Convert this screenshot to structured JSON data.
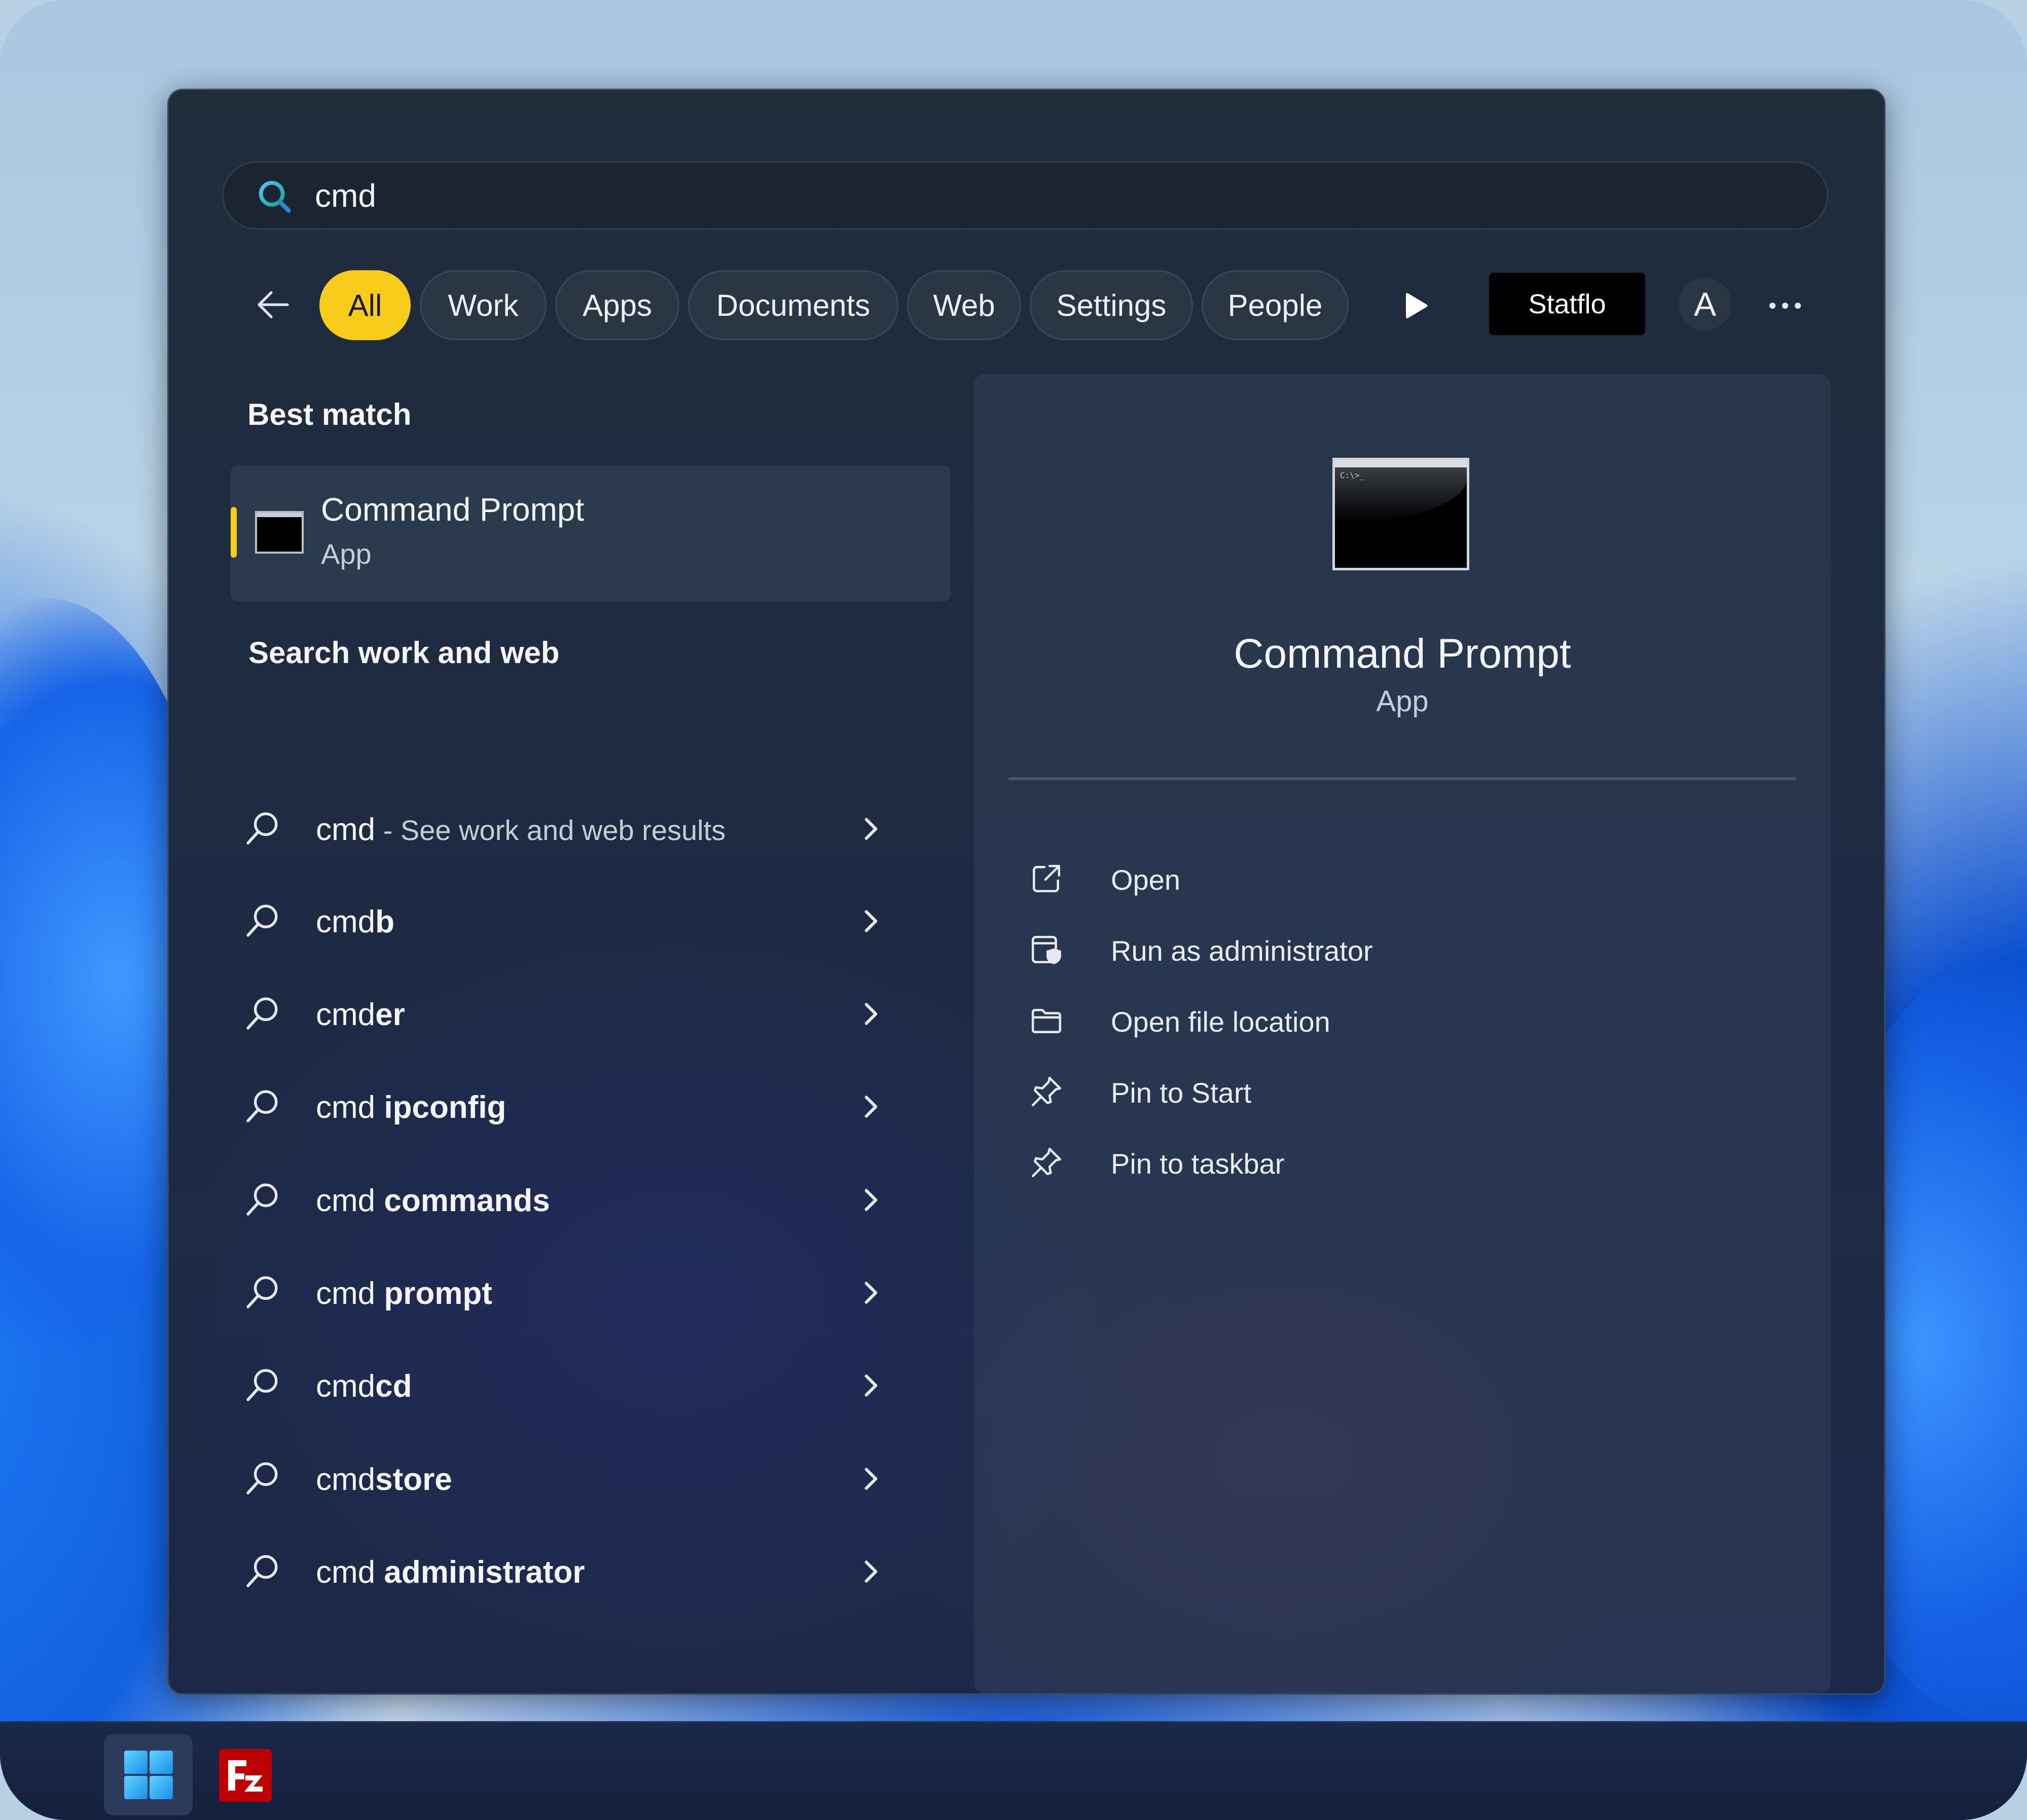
{
  "search": {
    "query": "cmd",
    "icon": "search-icon"
  },
  "filters": {
    "back_icon": "back-arrow-icon",
    "chips": [
      {
        "label": "All",
        "active": true
      },
      {
        "label": "Work",
        "active": false
      },
      {
        "label": "Apps",
        "active": false
      },
      {
        "label": "Documents",
        "active": false
      },
      {
        "label": "Web",
        "active": false
      },
      {
        "label": "Settings",
        "active": false
      },
      {
        "label": "People",
        "active": false
      }
    ],
    "more_filters_icon": "play-icon",
    "org_label": "Statflo",
    "avatar_initial": "A",
    "more_icon": "ellipsis-icon"
  },
  "best_match": {
    "heading": "Best match",
    "name": "Command Prompt",
    "type": "App",
    "icon": "command-prompt-icon"
  },
  "search_web": {
    "heading": "Search work and web",
    "results": [
      {
        "query": "cmd",
        "suggestion": "",
        "suffix": "See work and web results"
      },
      {
        "query": "cmd",
        "suggestion": "b",
        "suffix": ""
      },
      {
        "query": "cmd",
        "suggestion": "er",
        "suffix": ""
      },
      {
        "query": "cmd ",
        "suggestion": "ipconfig",
        "suffix": ""
      },
      {
        "query": "cmd ",
        "suggestion": "commands",
        "suffix": ""
      },
      {
        "query": "cmd ",
        "suggestion": "prompt",
        "suffix": ""
      },
      {
        "query": "cmd",
        "suggestion": "cd",
        "suffix": ""
      },
      {
        "query": "cmd",
        "suggestion": "store",
        "suffix": ""
      },
      {
        "query": "cmd ",
        "suggestion": "administrator",
        "suffix": ""
      }
    ]
  },
  "detail": {
    "name": "Command Prompt",
    "type": "App",
    "actions": [
      {
        "label": "Open",
        "icon": "open-external-icon"
      },
      {
        "label": "Run as administrator",
        "icon": "admin-shield-icon"
      },
      {
        "label": "Open file location",
        "icon": "folder-icon"
      },
      {
        "label": "Pin to Start",
        "icon": "pin-icon"
      },
      {
        "label": "Pin to taskbar",
        "icon": "pin-icon"
      }
    ]
  },
  "taskbar": {
    "items": [
      {
        "name": "Start",
        "icon": "windows-logo-icon"
      },
      {
        "name": "FileZilla",
        "icon": "filezilla-icon"
      }
    ]
  },
  "colors": {
    "accent": "#f7cc1b",
    "panel_bg": "#1e2b42",
    "text": "#f3f5f7"
  }
}
